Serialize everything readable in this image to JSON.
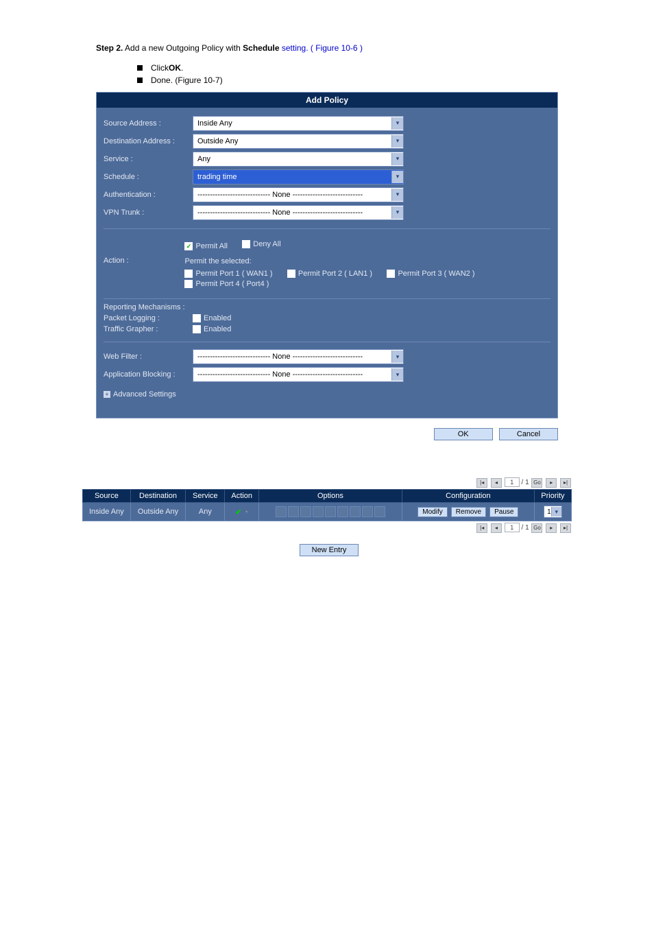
{
  "intro": {
    "step_label": "Step 2.",
    "step_text": " Add a new ",
    "outgoing_link": "Outgoing Policy",
    "with": " with ",
    "schedule_label": "Schedule",
    "setting": " setting. (",
    "figure_ref": "Figure 10-6",
    "close": ")",
    "bullet1": "Click ",
    "bullet1_bold": "OK",
    "bullet2": "Done. (",
    "bullet2_ref": "Figure 10-7",
    "bullet2_close": ")"
  },
  "panel": {
    "title": "Add Policy",
    "fields": {
      "source_label": "Source Address :",
      "source_value": "Inside Any",
      "dest_label": "Destination Address :",
      "dest_value": "Outside Any",
      "service_label": "Service :",
      "service_value": "Any",
      "schedule_label": "Schedule :",
      "schedule_value": "trading time",
      "auth_label": "Authentication :",
      "auth_value": "----------------------------- None ----------------------------",
      "vpn_label": "VPN Trunk :",
      "vpn_value": "----------------------------- None ----------------------------"
    },
    "action": {
      "label": "Action :",
      "permit_all": "Permit All",
      "deny_all": "Deny All",
      "permit_selected": "Permit the selected:",
      "p1": "Permit Port 1 ( WAN1 )",
      "p2": "Permit Port 2 ( LAN1 )",
      "p3": "Permit Port 3 ( WAN2 )",
      "p4": "Permit Port 4 ( Port4 )"
    },
    "reporting": {
      "label": "Reporting Mechanisms :",
      "packet_label": "Packet Logging :",
      "packet_value": "Enabled",
      "traffic_label": "Traffic Grapher :",
      "traffic_value": "Enabled"
    },
    "web": {
      "label": "Web Filter :",
      "value": "----------------------------- None ----------------------------",
      "app_label": "Application Blocking :",
      "app_value": "----------------------------- None ----------------------------"
    },
    "advanced": "Advanced Settings"
  },
  "buttons": {
    "ok": "OK",
    "cancel": "Cancel"
  },
  "pager": {
    "current": "1",
    "total": "/ 1",
    "go": "Go"
  },
  "table": {
    "h_source": "Source",
    "h_dest": "Destination",
    "h_service": "Service",
    "h_action": "Action",
    "h_options": "Options",
    "h_config": "Configuration",
    "h_priority": "Priority",
    "r_source": "Inside Any",
    "r_dest": "Outside Any",
    "r_service": "Any",
    "modify": "Modify",
    "remove": "Remove",
    "pause": "Pause",
    "priority": "1"
  },
  "new_entry": "New Entry"
}
